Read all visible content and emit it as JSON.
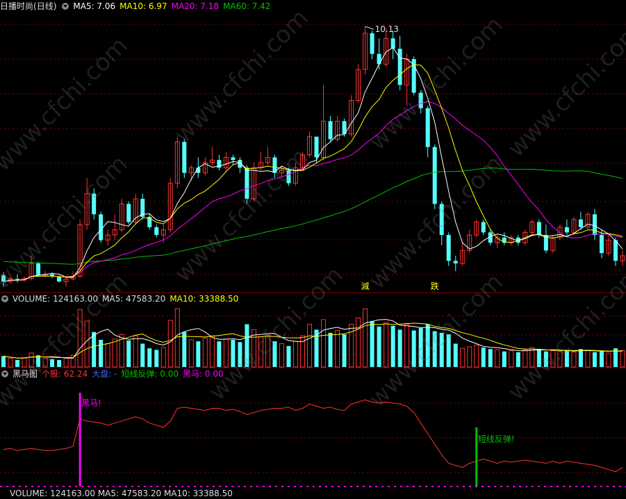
{
  "colors": {
    "bg": "#000000",
    "up": "#ff3232",
    "down": "#54ffff",
    "grid": "#8b0000",
    "ma5": "#ffffff",
    "ma10": "#ffff00",
    "ma20": "#ff00ff",
    "ma60": "#00c000",
    "text": "#dddddd"
  },
  "panel_main": {
    "title": "日播时尚",
    "period": "(日线)",
    "ma": [
      {
        "label": "MA5: 7.06",
        "color": "#ffffff"
      },
      {
        "label": "MA10: 6.97",
        "color": "#ffff00"
      },
      {
        "label": "MA20: 7.18",
        "color": "#ff00ff"
      },
      {
        "label": "MA60: 7.42",
        "color": "#00c000"
      }
    ],
    "high_label": "10.13",
    "markers": [
      "減",
      "跌"
    ]
  },
  "panel_volume": {
    "labels": [
      {
        "label": "VOLUME: 124163.00",
        "color": "#dddddd"
      },
      {
        "label": "MA5: 47583.20",
        "color": "#dddddd"
      },
      {
        "label": "MA10: 33388.50",
        "color": "#ffff00"
      }
    ]
  },
  "panel_indicator": {
    "labels": [
      {
        "label": "黑马图",
        "color": "#dddddd"
      },
      {
        "label": "个股: 62.24",
        "color": "#ff3232"
      },
      {
        "label": "大盘: -",
        "color": "#4060ff"
      },
      {
        "label": "短线反弹: 0.00",
        "color": "#00c000"
      },
      {
        "label": "黑马: 0.00",
        "color": "#ff00ff"
      }
    ],
    "signal_black_horse": "黑马!",
    "signal_rebound": "短线反弹!",
    "bottom_cut": "VOLUME: 124163.00  MA5: 47583.20  MA10: 33388.50"
  },
  "watermark": "www.cfchi.com",
  "chart_data": {
    "type": "candlestick",
    "n_bars": 90,
    "price_range": [
      5.0,
      10.4
    ],
    "high_value": 10.13,
    "ohlc": [
      [
        5.32,
        5.38,
        5.1,
        5.2
      ],
      [
        5.2,
        5.3,
        5.16,
        5.25
      ],
      [
        5.25,
        5.34,
        5.18,
        5.23
      ],
      [
        5.23,
        5.3,
        5.2,
        5.26
      ],
      [
        5.26,
        5.7,
        5.22,
        5.55
      ],
      [
        5.55,
        5.58,
        5.3,
        5.32
      ],
      [
        5.32,
        5.4,
        5.28,
        5.34
      ],
      [
        5.34,
        5.38,
        5.26,
        5.3
      ],
      [
        5.3,
        5.32,
        5.18,
        5.2
      ],
      [
        5.2,
        5.3,
        5.1,
        5.25
      ],
      [
        5.25,
        5.4,
        5.22,
        5.3
      ],
      [
        5.3,
        6.4,
        5.28,
        6.3
      ],
      [
        6.3,
        7.2,
        6.2,
        6.9
      ],
      [
        6.9,
        7.0,
        6.4,
        6.5
      ],
      [
        6.5,
        6.55,
        5.95,
        6.0
      ],
      [
        6.0,
        6.2,
        5.9,
        6.1
      ],
      [
        6.1,
        6.5,
        6.0,
        6.2
      ],
      [
        6.2,
        6.8,
        6.15,
        6.7
      ],
      [
        6.7,
        6.75,
        6.3,
        6.35
      ],
      [
        6.35,
        6.9,
        6.3,
        6.8
      ],
      [
        6.8,
        6.9,
        6.4,
        6.45
      ],
      [
        6.45,
        6.5,
        6.2,
        6.25
      ],
      [
        6.25,
        6.3,
        6.05,
        6.1
      ],
      [
        6.1,
        6.3,
        5.95,
        6.2
      ],
      [
        6.2,
        7.2,
        6.15,
        7.1
      ],
      [
        7.1,
        8.0,
        7.0,
        7.9
      ],
      [
        7.9,
        7.95,
        7.2,
        7.3
      ],
      [
        7.3,
        7.45,
        7.15,
        7.4
      ],
      [
        7.4,
        7.6,
        7.2,
        7.3
      ],
      [
        7.3,
        7.6,
        7.25,
        7.5
      ],
      [
        7.5,
        7.8,
        7.45,
        7.55
      ],
      [
        7.55,
        7.65,
        7.35,
        7.4
      ],
      [
        7.4,
        7.7,
        7.35,
        7.6
      ],
      [
        7.6,
        7.65,
        7.45,
        7.55
      ],
      [
        7.55,
        7.6,
        7.3,
        7.4
      ],
      [
        7.4,
        7.45,
        6.7,
        6.8
      ],
      [
        6.8,
        7.5,
        6.75,
        7.4
      ],
      [
        7.4,
        7.7,
        7.35,
        7.5
      ],
      [
        7.5,
        7.8,
        7.45,
        7.6
      ],
      [
        7.6,
        7.65,
        7.2,
        7.3
      ],
      [
        7.3,
        7.45,
        7.2,
        7.35
      ],
      [
        7.35,
        7.4,
        7.05,
        7.1
      ],
      [
        7.1,
        7.5,
        7.05,
        7.4
      ],
      [
        7.4,
        7.7,
        7.35,
        7.65
      ],
      [
        7.65,
        8.1,
        7.6,
        8.0
      ],
      [
        8.0,
        8.0,
        7.5,
        7.6
      ],
      [
        7.6,
        9.0,
        7.55,
        8.3
      ],
      [
        8.3,
        8.4,
        7.9,
        7.95
      ],
      [
        7.95,
        8.4,
        7.9,
        8.3
      ],
      [
        8.3,
        8.35,
        8.0,
        8.05
      ],
      [
        8.05,
        8.8,
        8.0,
        8.7
      ],
      [
        8.7,
        9.4,
        8.65,
        9.3
      ],
      [
        9.3,
        10.13,
        9.2,
        10.0
      ],
      [
        10.0,
        10.05,
        9.5,
        9.6
      ],
      [
        9.6,
        9.9,
        9.3,
        9.4
      ],
      [
        9.4,
        10.1,
        9.35,
        9.9
      ],
      [
        9.9,
        10.05,
        9.5,
        9.7
      ],
      [
        9.7,
        9.95,
        8.9,
        9.0
      ],
      [
        9.0,
        9.6,
        8.6,
        9.5
      ],
      [
        9.5,
        9.55,
        8.8,
        8.85
      ],
      [
        8.85,
        8.9,
        8.45,
        8.55
      ],
      [
        8.55,
        8.6,
        7.6,
        7.8
      ],
      [
        7.8,
        7.85,
        6.6,
        6.7
      ],
      [
        6.7,
        6.75,
        5.9,
        6.1
      ],
      [
        6.1,
        6.15,
        5.5,
        5.6
      ],
      [
        5.6,
        5.7,
        5.4,
        5.55
      ],
      [
        5.55,
        5.95,
        5.5,
        5.8
      ],
      [
        5.8,
        6.2,
        5.75,
        6.1
      ],
      [
        6.1,
        6.4,
        6.05,
        6.35
      ],
      [
        6.35,
        6.4,
        6.1,
        6.15
      ],
      [
        6.15,
        6.2,
        5.9,
        5.95
      ],
      [
        5.95,
        6.1,
        5.85,
        6.05
      ],
      [
        6.05,
        6.15,
        5.9,
        5.95
      ],
      [
        5.95,
        6.1,
        5.9,
        6.05
      ],
      [
        6.05,
        6.1,
        5.9,
        5.95
      ],
      [
        5.95,
        6.2,
        5.9,
        6.15
      ],
      [
        6.15,
        6.4,
        6.1,
        6.35
      ],
      [
        6.35,
        6.4,
        6.05,
        6.1
      ],
      [
        6.1,
        6.3,
        5.75,
        5.8
      ],
      [
        5.8,
        6.1,
        5.75,
        6.05
      ],
      [
        6.05,
        6.3,
        6.0,
        6.25
      ],
      [
        6.25,
        6.4,
        6.1,
        6.15
      ],
      [
        6.15,
        6.45,
        6.1,
        6.4
      ],
      [
        6.4,
        6.55,
        6.2,
        6.25
      ],
      [
        6.25,
        6.55,
        6.2,
        6.5
      ],
      [
        6.5,
        6.6,
        6.0,
        6.1
      ],
      [
        6.1,
        6.2,
        5.65,
        5.75
      ],
      [
        5.75,
        6.1,
        5.7,
        6.0
      ],
      [
        6.0,
        6.05,
        5.5,
        5.6
      ],
      [
        5.6,
        5.8,
        5.5,
        5.7
      ]
    ],
    "volume": [
      28,
      22,
      18,
      24,
      36,
      30,
      22,
      20,
      18,
      24,
      30,
      148,
      118,
      90,
      70,
      60,
      72,
      84,
      68,
      80,
      60,
      48,
      44,
      50,
      120,
      150,
      90,
      70,
      66,
      74,
      80,
      66,
      72,
      70,
      64,
      110,
      96,
      78,
      82,
      66,
      60,
      54,
      66,
      80,
      110,
      96,
      122,
      88,
      94,
      84,
      110,
      126,
      150,
      118,
      104,
      114,
      106,
      96,
      110,
      94,
      100,
      110,
      92,
      88,
      84,
      60,
      48,
      52,
      56,
      50,
      46,
      44,
      40,
      42,
      38,
      44,
      50,
      46,
      40,
      42,
      40,
      44,
      38,
      46,
      42,
      38,
      40,
      36,
      48,
      42
    ],
    "indicator_range": [
      0,
      100
    ],
    "indicator": [
      35,
      36,
      34,
      35,
      36,
      35,
      34,
      34,
      35,
      36,
      38,
      64,
      62,
      61,
      60,
      58,
      60,
      62,
      64,
      66,
      64,
      60,
      58,
      56,
      62,
      74,
      75,
      74,
      73,
      72,
      74,
      74,
      72,
      73,
      71,
      68,
      70,
      72,
      73,
      74,
      74,
      75,
      72,
      74,
      78,
      76,
      74,
      75,
      73,
      72,
      78,
      80,
      82,
      80,
      79,
      80,
      79,
      78,
      76,
      70,
      60,
      50,
      40,
      30,
      22,
      20,
      18,
      22,
      24,
      26,
      24,
      22,
      24,
      23,
      24,
      25,
      24,
      23,
      22,
      24,
      22,
      24,
      23,
      22,
      21,
      20,
      18,
      16,
      14,
      18
    ],
    "black_horse_signal_bar": 11,
    "rebound_signal_bar": 68
  }
}
